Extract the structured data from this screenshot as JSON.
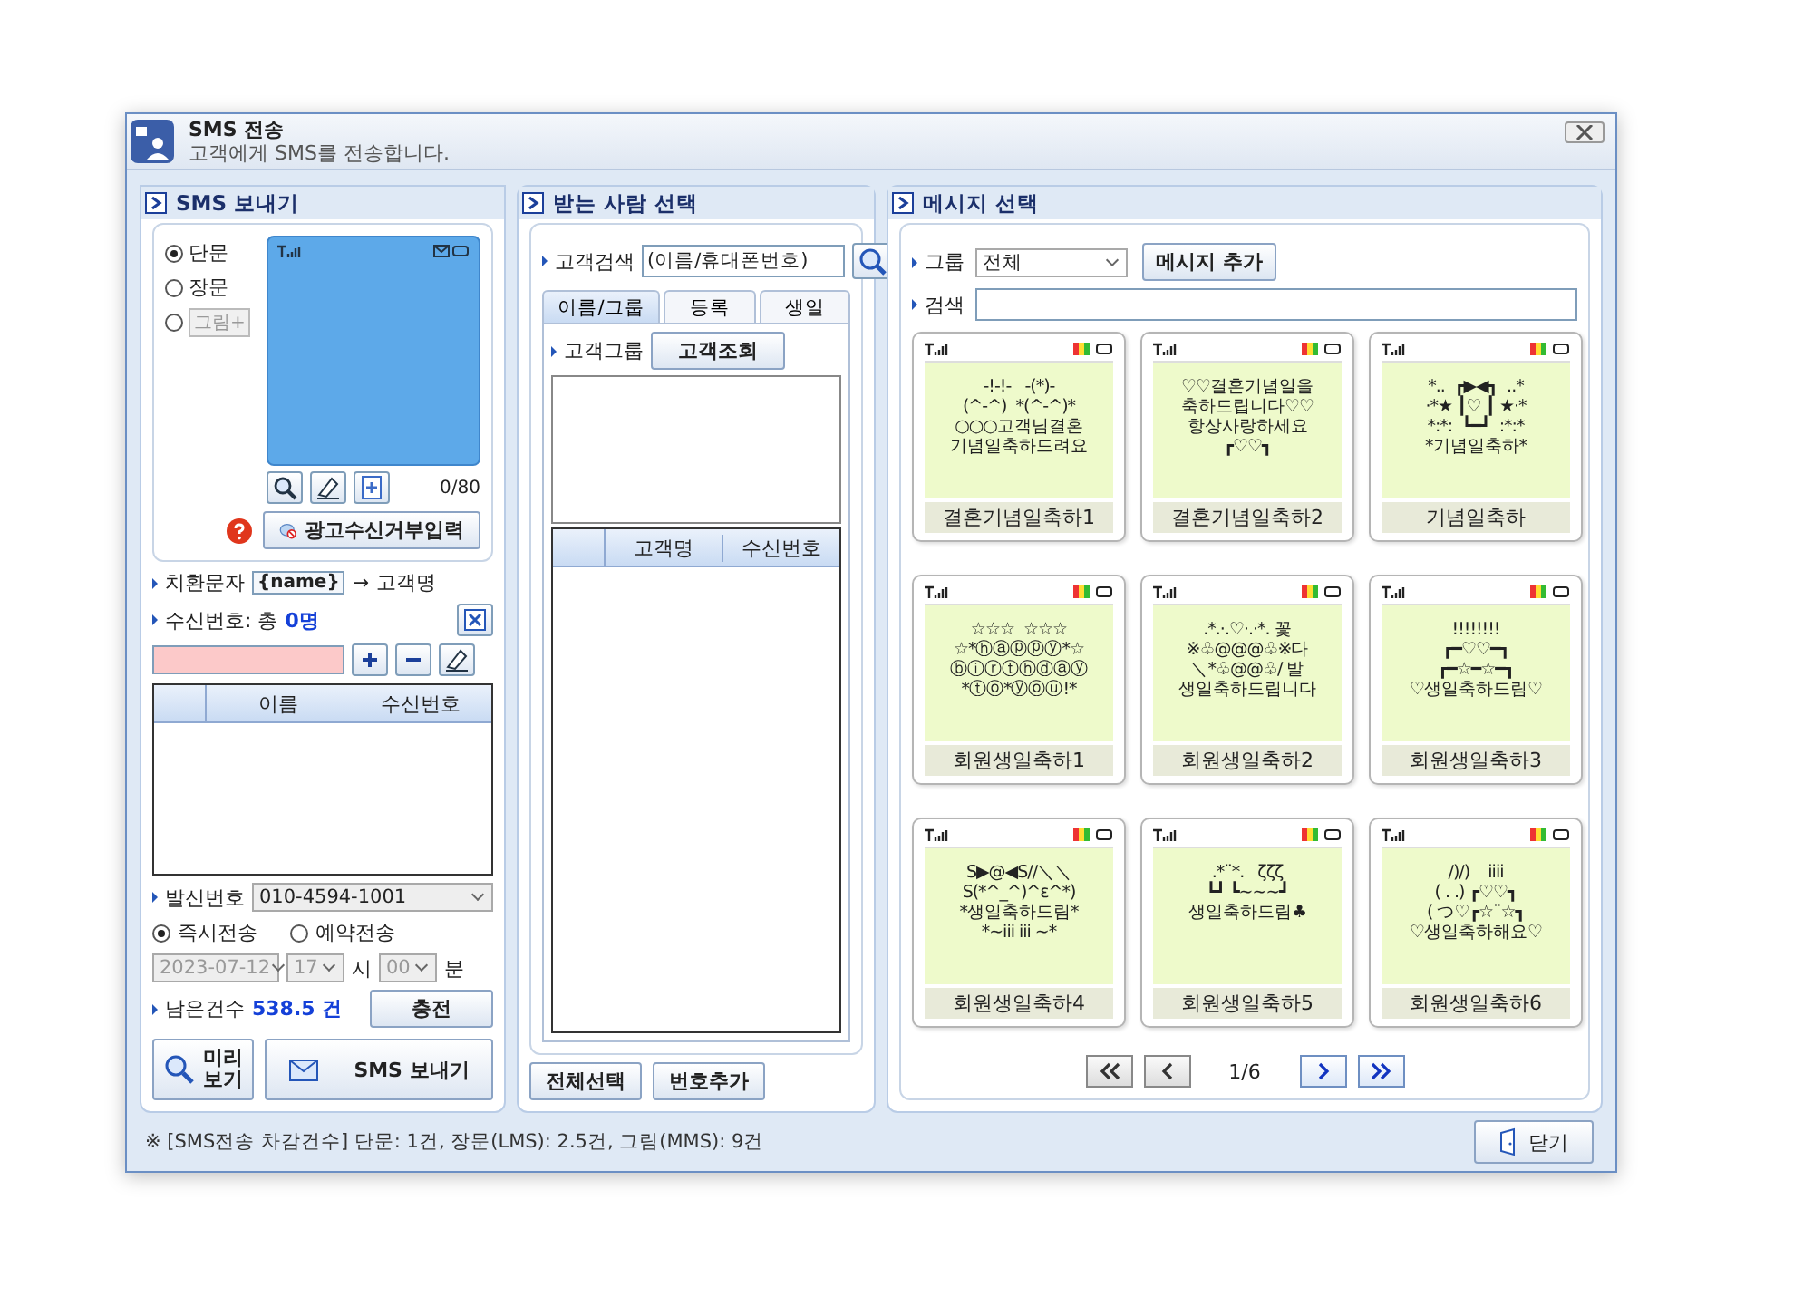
{
  "window": {
    "title": "SMS 전송",
    "subtitle": "고객에게 SMS를 전송합니다."
  },
  "compose": {
    "title": "SMS 보내기",
    "message_types": [
      {
        "kind": "radio",
        "label": "단문",
        "selected": true,
        "disabled": false
      },
      {
        "kind": "radio",
        "label": "장문",
        "selected": false,
        "disabled": false
      },
      {
        "kind": "chip",
        "label": "그림+",
        "selected": false,
        "disabled": true
      }
    ],
    "char_count": "0/80",
    "ad_reject_button": "광고수신거부입력",
    "substitution": {
      "label": "치환문자",
      "token": "{name}",
      "arrow": "→",
      "target": "고객명"
    },
    "recipients": {
      "label": "수신번호: 총",
      "count": "0명"
    },
    "columns": [
      "이름",
      "수신번호"
    ],
    "sender": {
      "label": "발신번호",
      "value": "010-4594-1001"
    },
    "send_modes": [
      {
        "label": "즉시전송",
        "selected": true
      },
      {
        "label": "예약전송",
        "selected": false
      }
    ],
    "schedule": {
      "disabled": true,
      "date": "2023-07-12",
      "hour": "17",
      "hour_unit": "시",
      "minute": "00",
      "minute_unit": "분"
    },
    "remaining": {
      "label": "남은건수",
      "value": "538.5 건",
      "charge_button": "충전"
    },
    "preview_button": "미리 보기",
    "send_button": "SMS 보내기"
  },
  "recipient_select": {
    "title": "받는 사람 선택",
    "search_label": "고객검색",
    "search_placeholder": "(이름/휴대폰번호)",
    "tabs": [
      {
        "label": "이름/그룹",
        "selected": true
      },
      {
        "label": "등록",
        "selected": false
      },
      {
        "label": "생일",
        "selected": false
      }
    ],
    "group_label": "고객그룹",
    "lookup_button": "고객조회",
    "columns": [
      "고객명",
      "수신번호"
    ],
    "buttons": [
      "전체선택",
      "번호추가"
    ]
  },
  "message_select": {
    "title": "메시지 선택",
    "group_label": "그룹",
    "group_value": "전체",
    "add_button": "메시지 추가",
    "search_label": "검색",
    "cards": [
      {
        "name": "결혼기념일축하1",
        "art": [
          "-!-!-   -(*)-",
          "(^-^)  *(^-^)*",
          "○○○고객님결혼",
          "기념일축하드려요"
        ]
      },
      {
        "name": "결혼기념일축하2",
        "art": [
          "♡♡결혼기념일을",
          "축하드립니다♡♡",
          "항상사랑하세요",
          "┏♡♡┓"
        ]
      },
      {
        "name": "기념일축하",
        "art": [
          "*..  ┏▶◀┓  ..*",
          "·*★ ┃♡ ┃ ★·*",
          "*:*:  ┗━┛  :*:*",
          "*기념일축하*"
        ]
      },
      {
        "name": "회원생일축하1",
        "art": [
          "☆☆☆  ☆☆☆",
          "☆*ⓗⓐⓟⓟⓨ*☆",
          "ⓑⓘⓡⓣⓗⓓⓐⓨ",
          "*ⓣⓞ*ⓨⓞⓤ!*"
        ]
      },
      {
        "name": "회원생일축하2",
        "art": [
          ".*.·.♡·.·*. 꽃",
          "※♧@@@♧※다",
          "＼*♧@@♧/ 발",
          "생일축하드립니다"
        ]
      },
      {
        "name": "회원생일축하3",
        "art": [
          "!!!!!!!!",
          "┏━♡♡━┓",
          "┏━☆━☆━┓",
          "♡생일축하드림♡"
        ]
      },
      {
        "name": "회원생일축하4",
        "art": [
          "S▶@◀S//＼＼",
          "S(*^_^)^ε^*)",
          "*생일축하드림*",
          "*~iii iii ~*"
        ]
      },
      {
        "name": "회원생일축하5",
        "art": [
          ".*¨*.   ζζζ",
          "┗┛ ┗~~~┛",
          "생일축하드림♣"
        ]
      },
      {
        "name": "회원생일축하6",
        "art": [
          "/)/)    iiii",
          "( . .) ┏♡♡┓",
          "( つ♡┏☆¨☆┓",
          "♡생일축하해요♡"
        ]
      }
    ],
    "pager": {
      "page": "1/6",
      "buttons": [
        {
          "kind": "first",
          "disabled": true
        },
        {
          "kind": "prev",
          "disabled": true
        },
        {
          "kind": "next",
          "disabled": false
        },
        {
          "kind": "last",
          "disabled": false
        }
      ]
    }
  },
  "footer": {
    "note": "※ [SMS전송 차감건수] 단문: 1건, 장문(LMS): 2.5건, 그림(MMS): 9건",
    "close_button": "닫기"
  }
}
